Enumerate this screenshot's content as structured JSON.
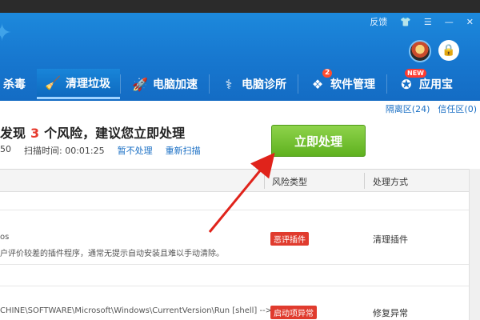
{
  "window": {
    "controls": [
      "反馈",
      "shirt-icon",
      "menu-icon",
      "minimize-icon",
      "close-icon"
    ],
    "feedback_label": "反馈"
  },
  "nav": {
    "tabs": [
      {
        "label": "杀毒",
        "icon": "virus-icon"
      },
      {
        "label": "清理垃圾",
        "icon": "broom-icon",
        "active": true
      },
      {
        "label": "电脑加速",
        "icon": "rocket-icon"
      },
      {
        "label": "电脑诊所",
        "icon": "stethoscope-icon"
      },
      {
        "label": "软件管理",
        "icon": "apps-icon",
        "badge": "2"
      },
      {
        "label": "应用宝",
        "icon": "app-store-icon",
        "badge": "NEW"
      }
    ]
  },
  "links": {
    "quarantine": "隔离区(24)",
    "trusted": "信任区(0)"
  },
  "scan": {
    "headline_prefix": "发现",
    "risk_count": "3",
    "headline_suffix": "个风险，建议您立即处理",
    "partial_value": "50",
    "scan_time_label": "扫描时间: 00:01:25",
    "ignore_link": "暂不处理",
    "rescan_link": "重新扫描",
    "action_button": "立即处理"
  },
  "table": {
    "headers": [
      "风险类型",
      "处理方式"
    ],
    "rows": [
      {
        "line1": "os",
        "line2": "户评价较差的插件程序，通常无提示自动安装且难以手动清除。",
        "tag": "恶评插件",
        "action": "清理插件"
      },
      {
        "line1": "CHINE\\SOFTWARE\\Microsoft\\Windows\\CurrentVersion\\Run [shell] --> C:\\...",
        "tag": "启动项异常",
        "action": "修复异常"
      }
    ]
  },
  "colors": {
    "header_blue": "#1777cf",
    "action_green": "#5fb11f",
    "risk_red": "#e63b2e",
    "link_blue": "#1a6fc4"
  }
}
